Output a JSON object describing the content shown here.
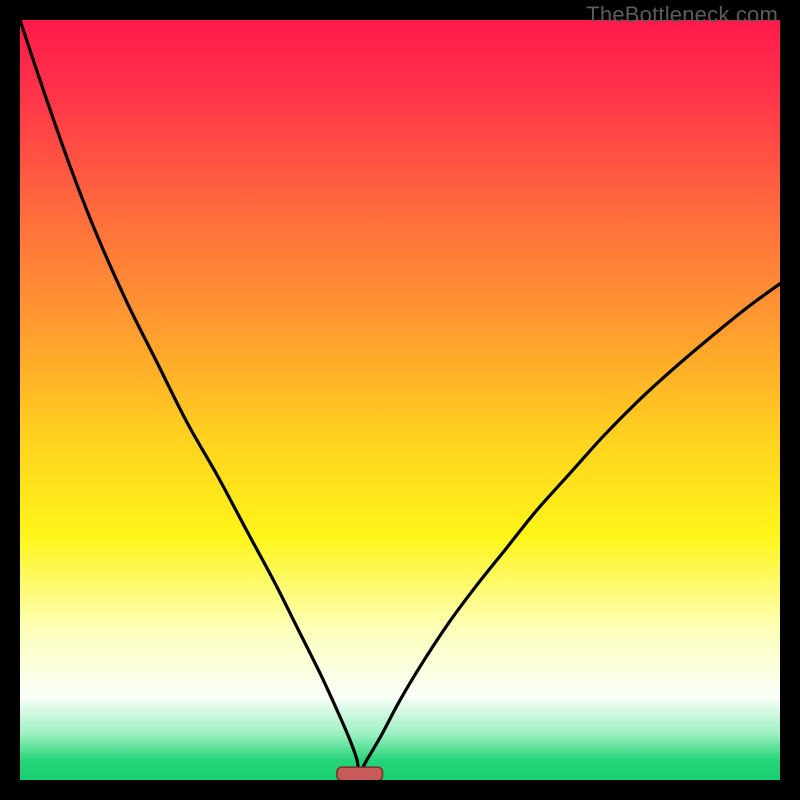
{
  "watermark": "TheBottleneck.com",
  "chart_data": {
    "type": "line",
    "title": "",
    "xlabel": "",
    "ylabel": "",
    "xlim": [
      0,
      100
    ],
    "ylim": [
      0,
      100
    ],
    "grid": false,
    "legend": false,
    "gradient_stops": [
      {
        "offset": 0.0,
        "color": "#ff1a4b"
      },
      {
        "offset": 0.1,
        "color": "#ff3449"
      },
      {
        "offset": 0.25,
        "color": "#ff6b3e"
      },
      {
        "offset": 0.4,
        "color": "#ff9a30"
      },
      {
        "offset": 0.55,
        "color": "#ffd21f"
      },
      {
        "offset": 0.68,
        "color": "#fff51a"
      },
      {
        "offset": 0.8,
        "color": "#fdffb8"
      },
      {
        "offset": 0.89,
        "color": "#fafff9"
      },
      {
        "offset": 0.94,
        "color": "#9bf0c0"
      },
      {
        "offset": 0.975,
        "color": "#24d478"
      },
      {
        "offset": 1.0,
        "color": "#19cf72"
      }
    ],
    "curve": {
      "x": [
        0.0,
        3.0,
        6.5,
        10.0,
        14.0,
        18.0,
        22.0,
        26.0,
        30.0,
        33.5,
        36.5,
        39.5,
        41.8,
        43.4,
        44.3,
        44.7,
        45.5,
        47.5,
        50.0,
        53.0,
        56.5,
        60.0,
        64.0,
        68.0,
        72.5,
        77.0,
        82.0,
        87.0,
        92.0,
        96.0,
        100.0
      ],
      "y": [
        100.0,
        91.0,
        81.0,
        72.0,
        63.0,
        55.0,
        47.0,
        40.0,
        32.5,
        26.0,
        20.0,
        14.0,
        9.0,
        5.3,
        2.8,
        1.0,
        2.4,
        5.8,
        10.5,
        15.5,
        20.8,
        25.5,
        30.5,
        35.5,
        40.5,
        45.5,
        50.5,
        55.0,
        59.2,
        62.4,
        65.3
      ]
    },
    "marker": {
      "shape": "rounded-bar",
      "x_center": 44.7,
      "y": 0.8,
      "width": 6.0,
      "height": 1.8,
      "fill": "#c65b59",
      "stroke": "#7a2d2c"
    }
  }
}
